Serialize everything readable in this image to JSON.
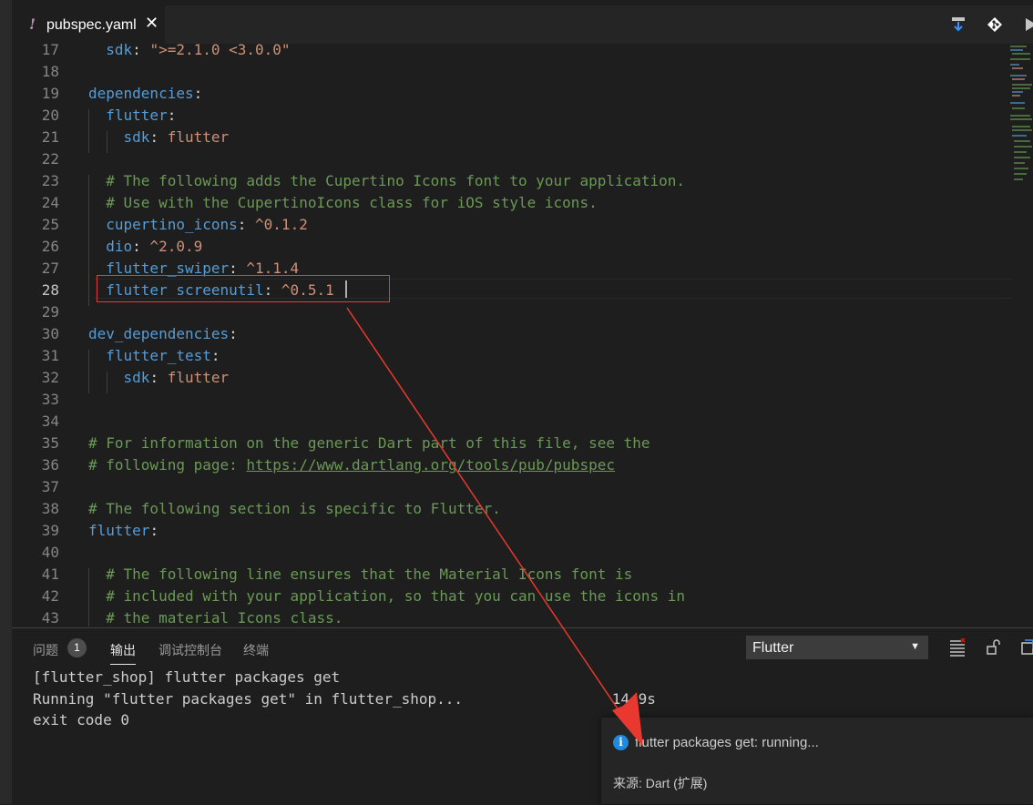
{
  "tab": {
    "label": "pubspec.yaml",
    "close": "✕",
    "icon_mark": "!"
  },
  "editor": {
    "lines": [
      {
        "n": "17",
        "tokens": [
          {
            "t": "  "
          },
          {
            "t": "sdk",
            "c": "k"
          },
          {
            "t": ": ",
            "c": "p"
          },
          {
            "t": "\">=2.1.0 <3.0.0\"",
            "c": "v"
          }
        ]
      },
      {
        "n": "18",
        "tokens": []
      },
      {
        "n": "19",
        "tokens": [
          {
            "t": "dependencies",
            "c": "k"
          },
          {
            "t": ":",
            "c": "p"
          }
        ]
      },
      {
        "n": "20",
        "tokens": [
          {
            "t": "  "
          },
          {
            "t": "flutter",
            "c": "k"
          },
          {
            "t": ":",
            "c": "p"
          }
        ]
      },
      {
        "n": "21",
        "tokens": [
          {
            "t": "    "
          },
          {
            "t": "sdk",
            "c": "k"
          },
          {
            "t": ": ",
            "c": "p"
          },
          {
            "t": "flutter",
            "c": "v"
          }
        ]
      },
      {
        "n": "22",
        "tokens": []
      },
      {
        "n": "23",
        "tokens": [
          {
            "t": "  "
          },
          {
            "t": "# The following adds the Cupertino Icons font to your application.",
            "c": "c"
          }
        ]
      },
      {
        "n": "24",
        "tokens": [
          {
            "t": "  "
          },
          {
            "t": "# Use with the CupertinoIcons class for iOS style icons.",
            "c": "c"
          }
        ]
      },
      {
        "n": "25",
        "tokens": [
          {
            "t": "  "
          },
          {
            "t": "cupertino_icons",
            "c": "k"
          },
          {
            "t": ": ",
            "c": "p"
          },
          {
            "t": "^0.1.2",
            "c": "v"
          }
        ]
      },
      {
        "n": "26",
        "tokens": [
          {
            "t": "  "
          },
          {
            "t": "dio",
            "c": "k"
          },
          {
            "t": ": ",
            "c": "p"
          },
          {
            "t": "^2.0.9",
            "c": "v"
          }
        ]
      },
      {
        "n": "27",
        "tokens": [
          {
            "t": "  "
          },
          {
            "t": "flutter_swiper",
            "c": "k"
          },
          {
            "t": ": ",
            "c": "p"
          },
          {
            "t": "^1.1.4",
            "c": "v"
          }
        ]
      },
      {
        "n": "28",
        "tokens": [
          {
            "t": "  "
          },
          {
            "t": "flutter_screenutil",
            "c": "k"
          },
          {
            "t": ": ",
            "c": "p"
          },
          {
            "t": "^0.5.1",
            "c": "v"
          }
        ],
        "current": true
      },
      {
        "n": "29",
        "tokens": []
      },
      {
        "n": "30",
        "tokens": [
          {
            "t": "dev_dependencies",
            "c": "k"
          },
          {
            "t": ":",
            "c": "p"
          }
        ]
      },
      {
        "n": "31",
        "tokens": [
          {
            "t": "  "
          },
          {
            "t": "flutter_test",
            "c": "k"
          },
          {
            "t": ":",
            "c": "p"
          }
        ]
      },
      {
        "n": "32",
        "tokens": [
          {
            "t": "    "
          },
          {
            "t": "sdk",
            "c": "k"
          },
          {
            "t": ": ",
            "c": "p"
          },
          {
            "t": "flutter",
            "c": "v"
          }
        ]
      },
      {
        "n": "33",
        "tokens": []
      },
      {
        "n": "34",
        "tokens": []
      },
      {
        "n": "35",
        "tokens": [
          {
            "t": "# For information on the generic Dart part of this file, see the",
            "c": "c"
          }
        ]
      },
      {
        "n": "36",
        "tokens": [
          {
            "t": "# following page: ",
            "c": "c"
          },
          {
            "t": "https://www.dartlang.org/tools/pub/pubspec",
            "c": "u"
          }
        ]
      },
      {
        "n": "37",
        "tokens": []
      },
      {
        "n": "38",
        "tokens": [
          {
            "t": "# The following section is specific to Flutter.",
            "c": "c"
          }
        ]
      },
      {
        "n": "39",
        "tokens": [
          {
            "t": "flutter",
            "c": "k"
          },
          {
            "t": ":",
            "c": "p"
          }
        ]
      },
      {
        "n": "40",
        "tokens": []
      },
      {
        "n": "41",
        "tokens": [
          {
            "t": "  "
          },
          {
            "t": "# The following line ensures that the Material Icons font is",
            "c": "c"
          }
        ]
      },
      {
        "n": "42",
        "tokens": [
          {
            "t": "  "
          },
          {
            "t": "# included with your application, so that you can use the icons in",
            "c": "c"
          }
        ]
      },
      {
        "n": "43",
        "tokens": [
          {
            "t": "  "
          },
          {
            "t": "# the material Icons class.",
            "c": "c"
          }
        ]
      }
    ]
  },
  "panel": {
    "tabs": {
      "problems": "问题",
      "problems_count": "1",
      "output": "输出",
      "debug_console": "调试控制台",
      "terminal": "终端"
    },
    "select_value": "Flutter",
    "select_arrow": "▼",
    "output_lines": [
      "[flutter_shop] flutter packages get",
      "Running \"flutter packages get\" in flutter_shop...                 14.9s",
      "exit code 0"
    ]
  },
  "notification": {
    "icon": "i",
    "message": "flutter packages get: running...",
    "source": "来源: Dart (扩展)"
  },
  "colors": {
    "keyword": "#569cd6",
    "value": "#ce9178",
    "comment": "#6a9955",
    "highlight_box": "#e23b3b",
    "arrow": "#e8382f"
  }
}
